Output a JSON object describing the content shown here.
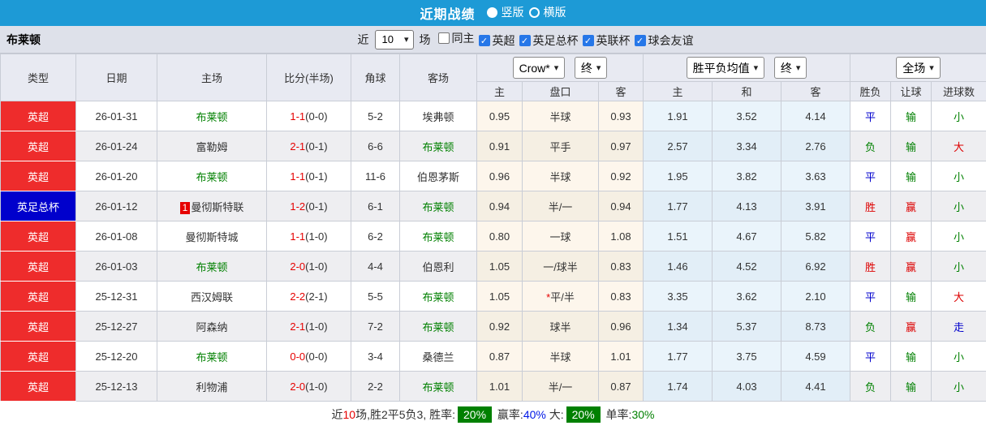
{
  "topbar": {
    "title": "近期战绩",
    "options": [
      {
        "label": "竖版",
        "selected": true
      },
      {
        "label": "横版",
        "selected": false
      }
    ]
  },
  "team": {
    "name": "布莱顿"
  },
  "filterbar": {
    "recent_label": "近",
    "recent_value": "10",
    "recent_suffix": "场",
    "same_home": {
      "label": "同主",
      "checked": false
    },
    "leagues": [
      {
        "label": "英超",
        "checked": true
      },
      {
        "label": "英足总杯",
        "checked": true
      },
      {
        "label": "英联杯",
        "checked": true
      },
      {
        "label": "球会友谊",
        "checked": true
      }
    ]
  },
  "table": {
    "columns": {
      "type": "类型",
      "date": "日期",
      "home": "主场",
      "score": "比分(半场)",
      "corner": "角球",
      "away": "客场"
    },
    "dropdowns": {
      "odds_source": "Crow*",
      "odds_time": "终",
      "avg_label": "胜平负均值",
      "avg_time": "终",
      "scope": "全场"
    },
    "subheaders": [
      "主",
      "盘口",
      "客",
      "主",
      "和",
      "客",
      "胜负",
      "让球",
      "进球数"
    ],
    "rows": [
      {
        "type": "英超",
        "date": "26-01-31",
        "home": "布莱顿",
        "score": "1-1",
        "half": "(0-0)",
        "corner": "5-2",
        "away": "埃弗顿",
        "oh": "0.95",
        "hd": "半球",
        "oa": "0.93",
        "ah": "1.91",
        "ad": "3.52",
        "aa": "4.14",
        "r1": "平",
        "r2": "输",
        "r3": "小"
      },
      {
        "type": "英超",
        "date": "26-01-24",
        "home": "富勒姆",
        "score": "2-1",
        "half": "(0-1)",
        "corner": "6-6",
        "away": "布莱顿",
        "oh": "0.91",
        "hd": "平手",
        "oa": "0.97",
        "ah": "2.57",
        "ad": "3.34",
        "aa": "2.76",
        "r1": "负",
        "r2": "输",
        "r3": "大"
      },
      {
        "type": "英超",
        "date": "26-01-20",
        "home": "布莱顿",
        "score": "1-1",
        "half": "(0-1)",
        "corner": "11-6",
        "away": "伯恩茅斯",
        "oh": "0.96",
        "hd": "半球",
        "oa": "0.92",
        "ah": "1.95",
        "ad": "3.82",
        "aa": "3.63",
        "r1": "平",
        "r2": "输",
        "r3": "小"
      },
      {
        "type": "英足总杯",
        "date": "26-01-12",
        "home": "曼彻斯特联",
        "home_badge": "1",
        "score": "1-2",
        "half": "(0-1)",
        "corner": "6-1",
        "away": "布莱顿",
        "oh": "0.94",
        "hd": "半/一",
        "oa": "0.94",
        "ah": "1.77",
        "ad": "4.13",
        "aa": "3.91",
        "r1": "胜",
        "r2": "赢",
        "r3": "小"
      },
      {
        "type": "英超",
        "date": "26-01-08",
        "home": "曼彻斯特城",
        "score": "1-1",
        "half": "(1-0)",
        "corner": "6-2",
        "away": "布莱顿",
        "oh": "0.80",
        "hd": "一球",
        "oa": "1.08",
        "ah": "1.51",
        "ad": "4.67",
        "aa": "5.82",
        "r1": "平",
        "r2": "赢",
        "r3": "小"
      },
      {
        "type": "英超",
        "date": "26-01-03",
        "home": "布莱顿",
        "score": "2-0",
        "half": "(1-0)",
        "corner": "4-4",
        "away": "伯恩利",
        "oh": "1.05",
        "hd": "一/球半",
        "oa": "0.83",
        "ah": "1.46",
        "ad": "4.52",
        "aa": "6.92",
        "r1": "胜",
        "r2": "赢",
        "r3": "小"
      },
      {
        "type": "英超",
        "date": "25-12-31",
        "home": "西汉姆联",
        "score": "2-2",
        "half": "(2-1)",
        "corner": "5-5",
        "away": "布莱顿",
        "oh": "1.05",
        "hd": "*平/半",
        "oa": "0.83",
        "ah": "3.35",
        "ad": "3.62",
        "aa": "2.10",
        "r1": "平",
        "r2": "输",
        "r3": "大"
      },
      {
        "type": "英超",
        "date": "25-12-27",
        "home": "阿森纳",
        "score": "2-1",
        "half": "(1-0)",
        "corner": "7-2",
        "away": "布莱顿",
        "oh": "0.92",
        "hd": "球半",
        "oa": "0.96",
        "ah": "1.34",
        "ad": "5.37",
        "aa": "8.73",
        "r1": "负",
        "r2": "赢",
        "r3": "走"
      },
      {
        "type": "英超",
        "date": "25-12-20",
        "home": "布莱顿",
        "score": "0-0",
        "half": "(0-0)",
        "corner": "3-4",
        "away": "桑德兰",
        "oh": "0.87",
        "hd": "半球",
        "oa": "1.01",
        "ah": "1.77",
        "ad": "3.75",
        "aa": "4.59",
        "r1": "平",
        "r2": "输",
        "r3": "小"
      },
      {
        "type": "英超",
        "date": "25-12-13",
        "home": "利物浦",
        "score": "2-0",
        "half": "(1-0)",
        "corner": "2-2",
        "away": "布莱顿",
        "oh": "1.01",
        "hd": "半/一",
        "oa": "0.87",
        "ah": "1.74",
        "ad": "4.03",
        "aa": "4.41",
        "r1": "负",
        "r2": "输",
        "r3": "小"
      }
    ]
  },
  "type_colors": {
    "英超": "#ee2c2c",
    "英足总杯": "#0000cc"
  },
  "value_colors": {
    "胜": "#dd0000",
    "平": "#0000cc",
    "负": "#008000",
    "赢": "#dd0000",
    "输": "#008000",
    "大": "#dd0000",
    "小": "#008000",
    "走": "#0000cc"
  },
  "footer": {
    "segments": [
      {
        "text": "近"
      },
      {
        "text": "10",
        "color": "red"
      },
      {
        "text": "场,胜2平5负3, 胜率:"
      },
      {
        "text": "20%",
        "badge": true
      },
      {
        "text": " 赢率:"
      },
      {
        "text": "40%",
        "color": "blue"
      },
      {
        "text": " 大:"
      },
      {
        "text": "20%",
        "badge": true
      },
      {
        "text": " 单率:"
      },
      {
        "text": "30%",
        "color": "green"
      }
    ]
  }
}
